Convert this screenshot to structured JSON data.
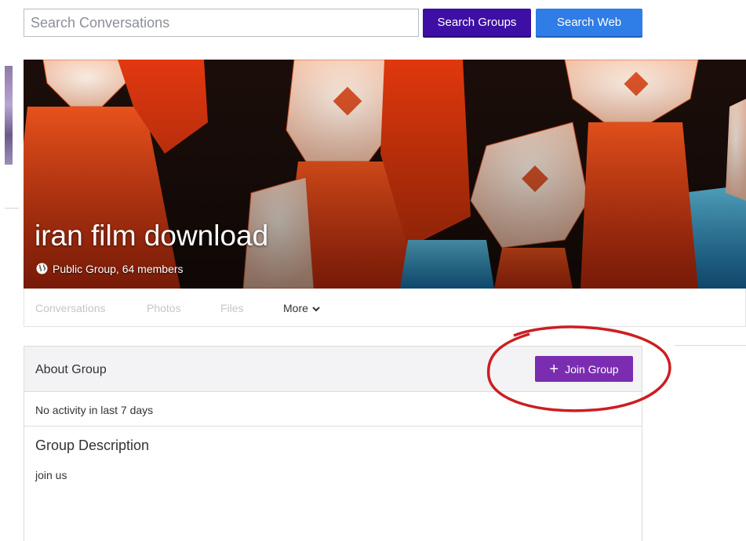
{
  "search": {
    "placeholder": "Search Conversations",
    "value": "",
    "groups_button": "Search Groups",
    "web_button": "Search Web"
  },
  "group": {
    "name": "iran film download",
    "meta": "Public Group, 64 members"
  },
  "tabs": [
    {
      "label": "Conversations"
    },
    {
      "label": "Photos"
    },
    {
      "label": "Files"
    },
    {
      "label": "More"
    }
  ],
  "about": {
    "title": "About Group",
    "join_button": "Join Group",
    "activity": "No activity in last 7 days",
    "description_title": "Group Description",
    "description": "join us"
  },
  "icons": {
    "globe": "globe-icon",
    "chevron": "chevron-down-icon",
    "plus": "plus-icon"
  },
  "colors": {
    "search_groups_bg": "#3d0fa4",
    "search_web_bg": "#2f7de6",
    "join_bg": "#7b2db1",
    "annotation": "#cc1e22"
  }
}
